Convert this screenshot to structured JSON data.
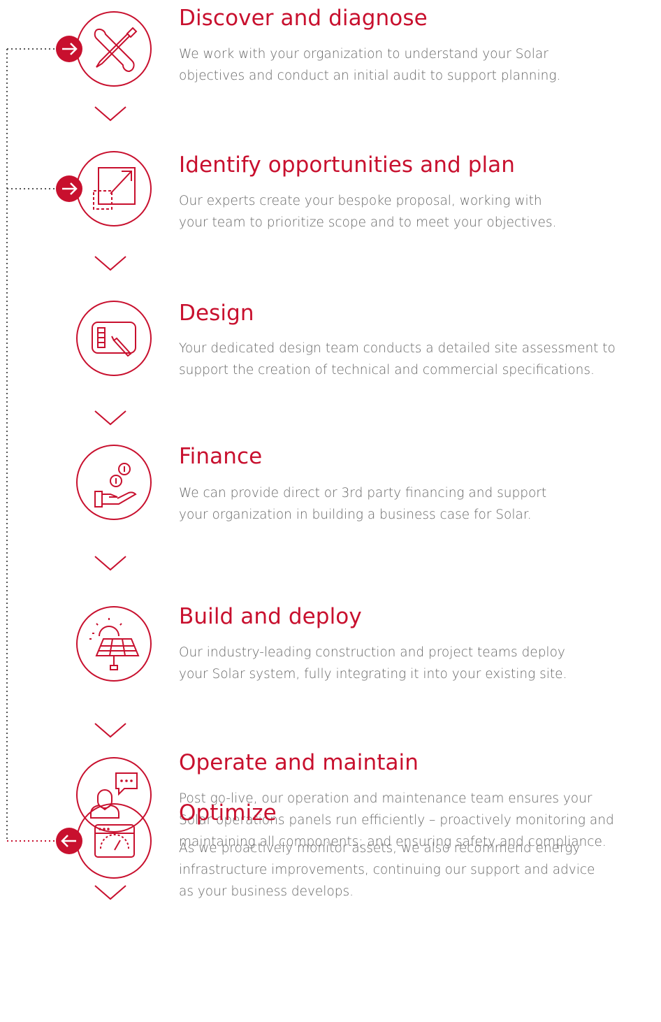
{
  "colors": {
    "accent": "#c8102e",
    "text": "#666666",
    "connector": "#555555"
  },
  "steps": [
    {
      "title": "Discover and diagnose",
      "lines": [
        "We work with your organization to understand your Solar",
        "objectives and conduct an initial audit to support planning."
      ],
      "icon": "wrench-screwdriver-icon",
      "arrow": "right"
    },
    {
      "title": "Identify opportunities and plan",
      "lines": [
        "Our experts create your bespoke proposal, working with",
        "your team to prioritize scope and to meet your objectives."
      ],
      "icon": "expand-square-icon",
      "arrow": "right"
    },
    {
      "title": "Design",
      "lines": [
        "Your dedicated design team conducts a detailed site assessment to",
        "support the creation of technical and commercial specifications."
      ],
      "icon": "design-tablet-icon",
      "arrow": ""
    },
    {
      "title": "Finance",
      "lines": [
        "We can provide direct or 3rd party financing and support",
        "your organization in building a business case for Solar."
      ],
      "icon": "hand-coins-icon",
      "arrow": ""
    },
    {
      "title": "Build and deploy",
      "lines": [
        "Our industry-leading construction and project teams deploy",
        "your Solar system, fully integrating it into your existing site."
      ],
      "icon": "solar-panel-icon",
      "arrow": ""
    },
    {
      "title": "Operate and maintain",
      "lines": [
        "Post go-live, our operation and maintenance team ensures your",
        "Solar operations panels run efficiently – proactively monitoring and",
        "maintaining all components; and ensuring safety and compliance."
      ],
      "icon": "person-chat-icon",
      "arrow": ""
    },
    {
      "title": "Optimize",
      "lines": [
        "As we proactively monitor assets, we also recommend energy",
        "infrastructure improvements, continuing our support and advice",
        "as your business develops."
      ],
      "icon": "dashboard-gauge-icon",
      "arrow": "left"
    }
  ]
}
